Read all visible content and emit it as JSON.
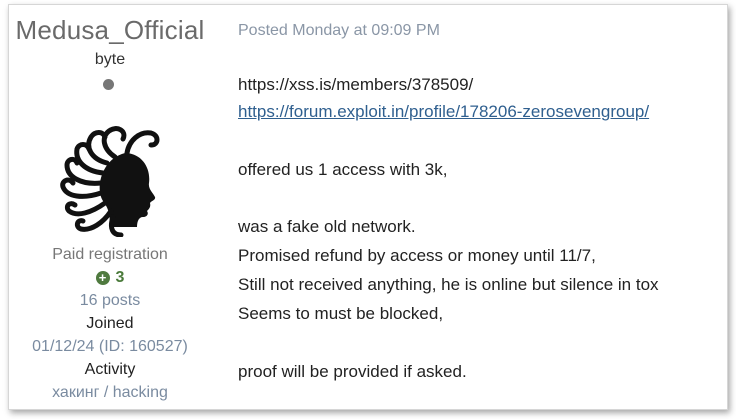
{
  "author": {
    "username": "Medusa_Official",
    "title": "byte",
    "group": "Paid registration",
    "reputation": "3",
    "posts": "16 posts",
    "joined_label": "Joined",
    "joined_value": "01/12/24 (ID: 160527)",
    "activity_label": "Activity",
    "activity_value": "хакинг / hacking"
  },
  "post": {
    "posted": "Posted Monday at 09:09 PM",
    "lines": [
      "https://xss.is/members/378509/",
      "https://forum.exploit.in/profile/178206-zerosevengroup/",
      "offered us 1 access with 3k,",
      "was a fake old network.",
      "Promised refund by access or money until 11/7,",
      "Still not received anything, he is online but silence in tox",
      "Seems to must be blocked,",
      "proof will be provided if asked."
    ]
  },
  "colors": {
    "username": "#6a6a6a",
    "muted": "#7a8ba0",
    "reputation": "#4a7a3a",
    "link": "#2f5f8f"
  },
  "icons": {
    "status": "status-dot",
    "reputation": "plus-circle-icon",
    "avatar": "medusa-head-avatar"
  }
}
